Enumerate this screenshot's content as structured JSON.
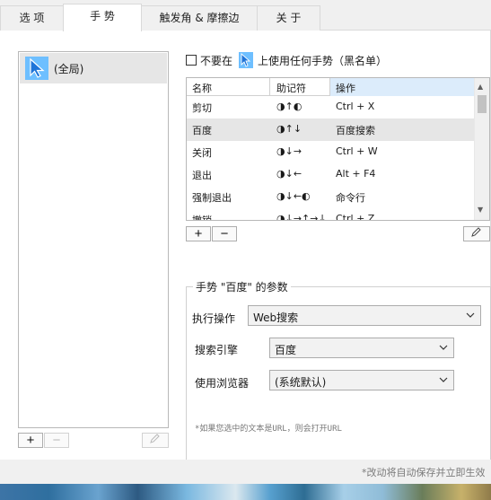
{
  "tabs": [
    {
      "label": "选 项",
      "active": false
    },
    {
      "label": "手 势",
      "active": true
    },
    {
      "label": "触发角 & 摩擦边",
      "active": false
    },
    {
      "label": "关 于",
      "active": false
    }
  ],
  "left": {
    "items": [
      {
        "label": "(全局)",
        "icon": "cursor-arrow-icon"
      }
    ],
    "add_label": "+",
    "remove_label": "−",
    "edit_icon": "edit-icon"
  },
  "blacklist": {
    "checked": false,
    "text_before": "不要在",
    "text_after": "上使用任何手势（黑名单）"
  },
  "table": {
    "columns": [
      "名称",
      "助记符",
      "操作"
    ],
    "rows": [
      {
        "name": "剪切",
        "mnemonic": "◑↑◐",
        "action": "Ctrl + X",
        "selected": false
      },
      {
        "name": "百度",
        "mnemonic": "◑↑↓",
        "action": "百度搜索",
        "selected": true
      },
      {
        "name": "关闭",
        "mnemonic": "◑↓→",
        "action": "Ctrl + W",
        "selected": false
      },
      {
        "name": "退出",
        "mnemonic": "◑↓←",
        "action": "Alt + F4",
        "selected": false
      },
      {
        "name": "强制退出",
        "mnemonic": "◑↓←◐",
        "action": "命令行",
        "selected": false
      },
      {
        "name": "撤销",
        "mnemonic": "◑↓→↑→↓",
        "action": "Ctrl + Z",
        "selected": false
      }
    ],
    "add_label": "+",
    "remove_label": "−",
    "edit_icon": "edit-icon"
  },
  "params": {
    "title": "手势 \"百度\" 的参数",
    "fields": [
      {
        "label": "执行操作",
        "value": "Web搜索"
      },
      {
        "label": "搜索引擎",
        "value": "百度"
      },
      {
        "label": "使用浏览器",
        "value": "(系统默认)"
      }
    ],
    "hint": "*如果您选中的文本是URL，则会打开URL"
  },
  "footer": {
    "text": "*改动将自动保存并立即生效"
  },
  "colors": {
    "accent": "#dcecfb",
    "cursor": "#1e74d8"
  }
}
